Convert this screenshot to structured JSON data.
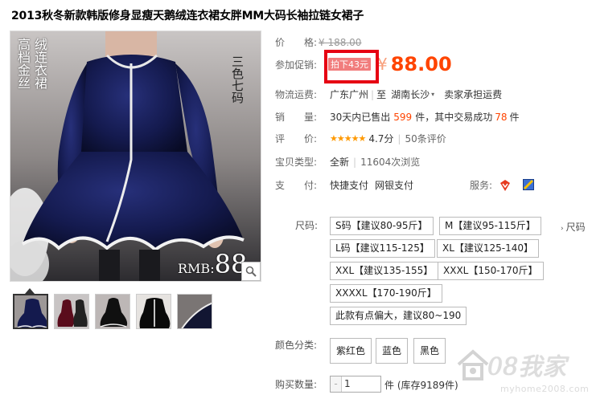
{
  "product": {
    "title": "2013秋冬新款韩版修身显瘦天鹅绒连衣裙女胖MM大码长袖拉链女裙子"
  },
  "image": {
    "vertical_text_1": "高档金丝",
    "vertical_text_2": "绒连衣裙",
    "vertical_text_3": "三色七码",
    "rmb_label": "RMB:",
    "rmb_value": "88"
  },
  "price": {
    "label": "价　　格:",
    "original": "¥ 188.00"
  },
  "promo": {
    "label": "参加促销:",
    "tag": "拍下43元",
    "currency": "¥",
    "price": "88.00"
  },
  "shipping": {
    "label": "物流运费:",
    "from": "广东广州",
    "to_prefix": "至",
    "to": "湖南长沙",
    "fee": "卖家承担运费"
  },
  "sales": {
    "label": "销　　量:",
    "prefix": "30天内已售出",
    "sold": "599",
    "middle": "件，其中交易成功",
    "success": "78",
    "suffix": "件"
  },
  "rating": {
    "label": "评　　价:",
    "stars": "★★★★★",
    "score": "4.7分",
    "reviews": "50条评价"
  },
  "condition": {
    "label": "宝贝类型:",
    "value": "全新",
    "views": "11604次浏览"
  },
  "payment": {
    "label": "支　　付:",
    "method1": "快捷支付",
    "method2": "网银支付",
    "service_label": "服务:"
  },
  "size": {
    "label": "尺码:",
    "options": [
      "S码【建议80-95斤】",
      "M【建议95-115斤】",
      "L码【建议115-125】",
      "XL【建议125-140】",
      "XXL【建议135-155】",
      "XXXL【150-170斤】",
      "XXXXL【170-190斤】",
      "此款有点偏大，建议80~190"
    ],
    "chart_link": "尺码"
  },
  "color": {
    "label": "颜色分类:",
    "options": [
      "紫红色",
      "蓝色",
      "黑色"
    ]
  },
  "quantity": {
    "label": "购买数量:",
    "value": "1",
    "stock_note": "件 (库存9189件)"
  },
  "watermark": {
    "text": "08我家",
    "url": "myhome2008.com"
  },
  "colors": {
    "price_orange": "#ff4400",
    "promo_border": "#e60012",
    "dress_blue": "#141a4e"
  }
}
